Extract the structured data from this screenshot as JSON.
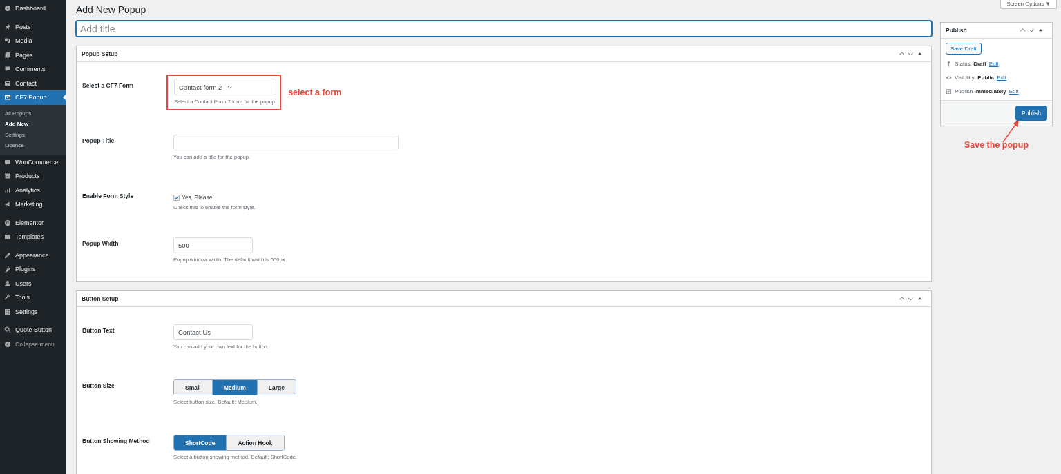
{
  "sidebar": {
    "groups": [
      {
        "items": [
          {
            "label": "Dashboard",
            "kind": "menu",
            "selected": false
          }
        ]
      },
      {
        "items": [
          {
            "label": "Posts",
            "kind": "menu",
            "selected": false
          },
          {
            "label": "Media",
            "kind": "menu",
            "selected": false
          },
          {
            "label": "Pages",
            "kind": "menu",
            "selected": false
          },
          {
            "label": "Comments",
            "kind": "menu",
            "selected": false
          },
          {
            "label": "Contact",
            "kind": "menu",
            "selected": false
          },
          {
            "label": "CF7 Popup",
            "kind": "menu",
            "selected": true,
            "children": [
              {
                "label": "All Popups",
                "selected": false
              },
              {
                "label": "Add New",
                "selected": true
              },
              {
                "label": "Settings",
                "selected": false
              },
              {
                "label": "License",
                "selected": false
              }
            ]
          }
        ]
      },
      {
        "items": [
          {
            "label": "WooCommerce",
            "kind": "menu",
            "selected": false
          },
          {
            "label": "Products",
            "kind": "menu",
            "selected": false
          },
          {
            "label": "Analytics",
            "kind": "menu",
            "selected": false
          },
          {
            "label": "Marketing",
            "kind": "menu",
            "selected": false
          }
        ]
      },
      {
        "items": [
          {
            "label": "Elementor",
            "kind": "menu",
            "selected": false
          },
          {
            "label": "Templates",
            "kind": "menu",
            "selected": false
          }
        ]
      },
      {
        "items": [
          {
            "label": "Appearance",
            "kind": "menu",
            "selected": false
          },
          {
            "label": "Plugins",
            "kind": "menu",
            "selected": false
          },
          {
            "label": "Users",
            "kind": "menu",
            "selected": false
          },
          {
            "label": "Tools",
            "kind": "menu",
            "selected": false
          },
          {
            "label": "Settings",
            "kind": "menu",
            "selected": false
          }
        ]
      },
      {
        "items": [
          {
            "label": "Quote Button",
            "kind": "menu",
            "selected": false
          },
          {
            "label": "Collapse menu",
            "kind": "collapse",
            "selected": false
          }
        ]
      }
    ]
  },
  "page_title": "Add New Popup",
  "title_field": {
    "placeholder": "Add title"
  },
  "screen_options": "Screen Options ▼",
  "panels": [
    {
      "title": "Popup Setup",
      "fields": [
        {
          "kind": "select",
          "label": "Select a CF7 Form",
          "value": "Contact form 2",
          "description": "Select a Contact Form 7 form for the popup.",
          "highlighted": true,
          "annotation": "select a form"
        },
        {
          "kind": "text",
          "label": "Popup Title",
          "description": "You can add a title for the popup."
        },
        {
          "kind": "checkbox",
          "label": "Enable Form Style",
          "option": "Yes, Please!",
          "checked": true,
          "description": "Check this to enable the form style."
        },
        {
          "kind": "short-text",
          "label": "Popup Width",
          "value": "500",
          "description": "Popup window width. The default width is 500px"
        }
      ]
    },
    {
      "title": "Button Setup",
      "fields": [
        {
          "kind": "short-text",
          "label": "Button Text",
          "value": "Contact Us",
          "description": "You can add your own text for the button."
        },
        {
          "kind": "segmented",
          "label": "Button Size",
          "options": [
            {
              "label": "Small",
              "selected": false
            },
            {
              "label": "Medium",
              "selected": true
            },
            {
              "label": "Large",
              "selected": false
            }
          ],
          "description": "Select button size. Default: Medium."
        },
        {
          "kind": "segmented",
          "label": "Button Showing Method",
          "options": [
            {
              "label": "ShortCode",
              "selected": true
            },
            {
              "label": "Action Hook",
              "selected": false
            }
          ],
          "description": "Select a button showing method. Default: ShortCode."
        }
      ]
    }
  ],
  "publish": {
    "title": "Publish",
    "save_draft": "Save Draft",
    "rows": [
      {
        "text": "Status: **Draft**",
        "link": "Edit"
      },
      {
        "text": "Visibility: **Public**",
        "link": "Edit"
      },
      {
        "text": "Publish **immediately**",
        "link": "Edit"
      }
    ],
    "button": "Publish",
    "annotation": "Save the popup"
  }
}
